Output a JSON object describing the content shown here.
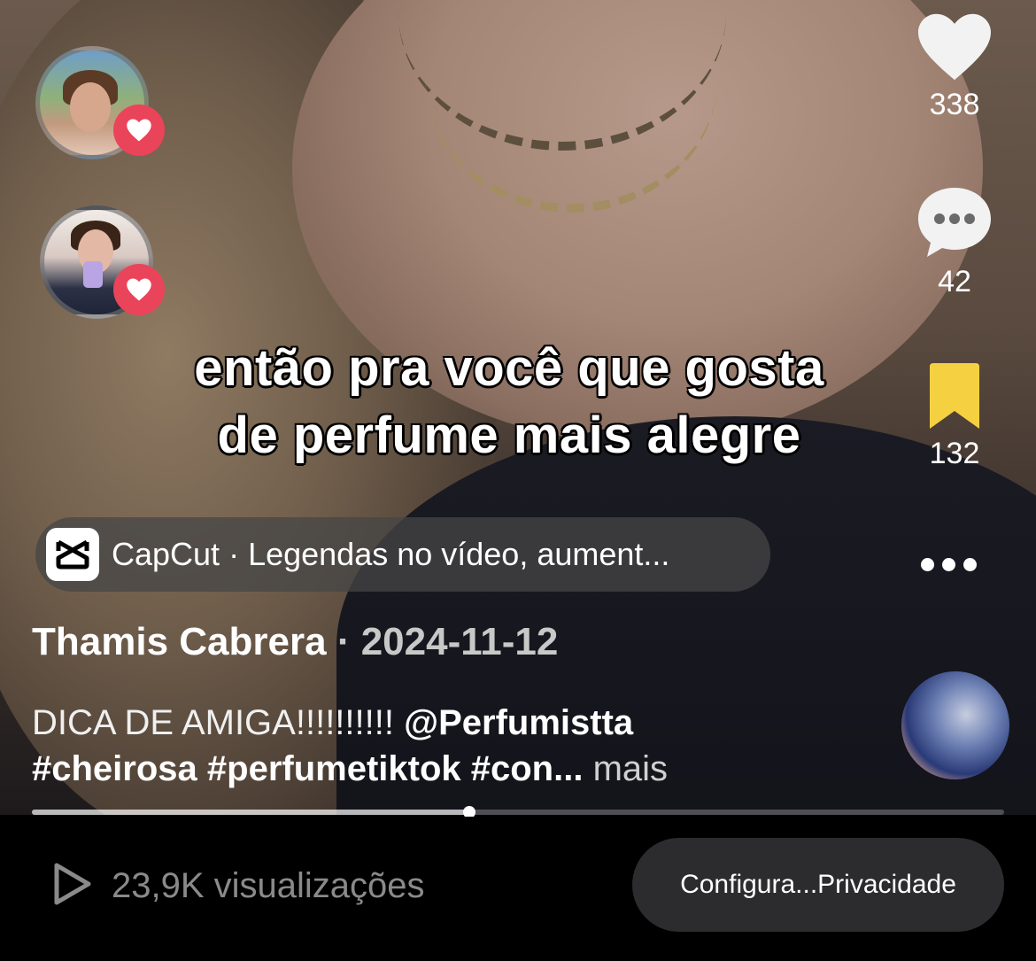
{
  "video": {
    "caption_line1": "então pra você que gosta",
    "caption_line2": "de perfume mais alegre"
  },
  "right_rail": {
    "likes": "338",
    "comments": "42",
    "saves": "132",
    "save_color": "#f5d142"
  },
  "chip": {
    "app_name": "CapCut",
    "text": "· Legendas no vídeo, aument..."
  },
  "post": {
    "author": "Thamis Cabrera",
    "separator": "·",
    "date": "2024-11-12",
    "desc_plain": "DICA DE AMIGA!!!!!!!!!! ",
    "mention": "@Perfumistta",
    "hashtags": "#cheirosa #perfumetiktok #con...",
    "more": "mais",
    "progress": 0.45
  },
  "bottom": {
    "views": "23,9K visualizações",
    "privacy_button": "Configura...Privacidade"
  },
  "colors": {
    "like_badge": "#ea445a",
    "chip_bg": "#464646",
    "button_bg": "#2c2c2e"
  }
}
